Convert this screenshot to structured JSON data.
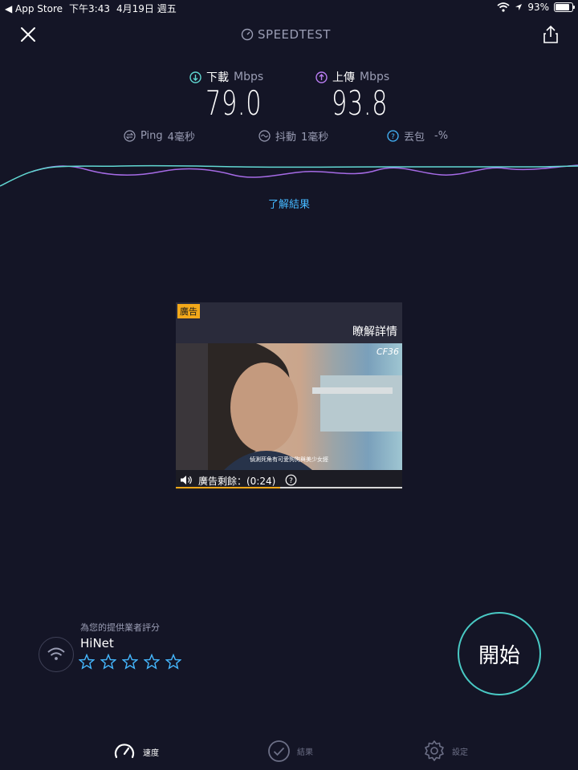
{
  "status_bar": {
    "back_label": "◀ App Store",
    "time": "下午3:43",
    "date": "4月19日 週五",
    "battery": "93%",
    "battery_level": 0.93
  },
  "header": {
    "title": "SPEEDTEST"
  },
  "results": {
    "download": {
      "label": "下載",
      "unit": "Mbps",
      "value": "79.0"
    },
    "upload": {
      "label": "上傳",
      "unit": "Mbps",
      "value": "93.8"
    },
    "ping": {
      "label": "Ping",
      "value": "4毫秒"
    },
    "jitter": {
      "label": "抖動",
      "value": "1毫秒"
    },
    "packet_loss": {
      "label": "丟包",
      "value": "-%"
    }
  },
  "learn_link": "了解結果",
  "ad": {
    "badge": "廣告",
    "learn_more": "瞭解詳情",
    "logo": "CF36",
    "subtitle": "偵測死角有可愛狗狗與美少女經",
    "remaining": "廣告剩餘：(0:24)",
    "progress": 0.46
  },
  "provider": {
    "caption": "為您的提供業者評分",
    "name": "HiNet",
    "rating": 0,
    "max_rating": 5
  },
  "go_button": "開始",
  "tabs": [
    {
      "label": "速度",
      "icon": "speed-gauge-icon",
      "active": true
    },
    {
      "label": "結果",
      "icon": "check-circle-icon",
      "active": false
    },
    {
      "label": "設定",
      "icon": "gear-icon",
      "active": false
    }
  ],
  "colors": {
    "background": "#141526",
    "download_accent": "#5fd6d0",
    "upload_accent": "#b87cf0",
    "link": "#45b8ff",
    "go_ring": "#49c9c4",
    "ad_badge": "#f2a81a"
  }
}
